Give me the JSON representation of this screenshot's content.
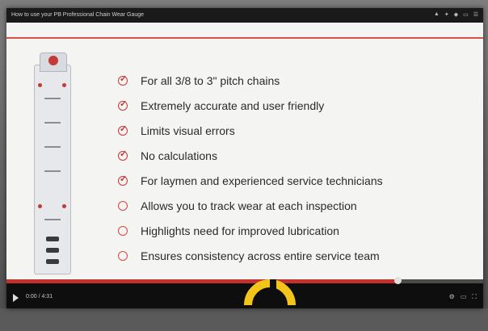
{
  "window": {
    "title": "How to use your PB Professional Chain Wear Gauge",
    "controls": [
      "▲",
      "✦",
      "◆",
      "▭",
      "☰"
    ]
  },
  "slide": {
    "items": [
      {
        "text": "For all 3/8 to 3\" pitch chains",
        "icon": "check-circle-icon"
      },
      {
        "text": "Extremely accurate and user friendly",
        "icon": "check-circle-icon"
      },
      {
        "text": "Limits visual errors",
        "icon": "check-circle-icon"
      },
      {
        "text": "No calculations",
        "icon": "check-circle-icon"
      },
      {
        "text": "For laymen and experienced service technicians",
        "icon": "check-circle-icon"
      },
      {
        "text": "Allows you to track wear at each inspection",
        "icon": "empty-circle-icon"
      },
      {
        "text": "Highlights need for improved lubrication",
        "icon": "empty-circle-icon"
      },
      {
        "text": "Ensures consistency across entire service team",
        "icon": "empty-circle-icon"
      }
    ]
  },
  "player": {
    "time": "0:00 / 4:31",
    "progress_played": 0.82,
    "progress_buffered": 0.82,
    "right_controls": [
      "⚙",
      "▭",
      "⛶"
    ],
    "accent": "#c4302b",
    "loading_color": "#f3c51a"
  }
}
